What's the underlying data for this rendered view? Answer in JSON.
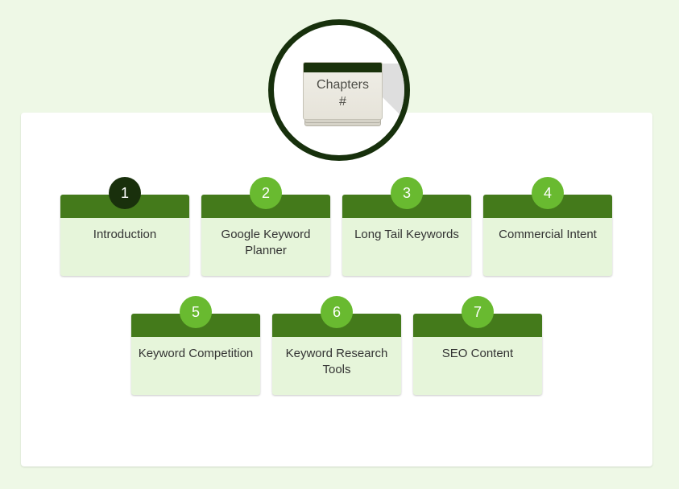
{
  "header": {
    "book_title": "Chapters",
    "book_subtitle": "#"
  },
  "chapters": [
    {
      "number": "1",
      "title": "Introduction",
      "active": true
    },
    {
      "number": "2",
      "title": "Google Keyword Planner",
      "active": false
    },
    {
      "number": "3",
      "title": "Long Tail Keywords",
      "active": false
    },
    {
      "number": "4",
      "title": "Commercial Intent",
      "active": false
    },
    {
      "number": "5",
      "title": "Keyword Competition",
      "active": false
    },
    {
      "number": "6",
      "title": "Keyword Research Tools",
      "active": false
    },
    {
      "number": "7",
      "title": "SEO Content",
      "active": false
    }
  ],
  "colors": {
    "page_background": "#eef8e6",
    "card_header": "#447a1b",
    "card_body": "#e6f5da",
    "badge": "#69ba30",
    "badge_active": "#19300c",
    "ring": "#17300c"
  }
}
